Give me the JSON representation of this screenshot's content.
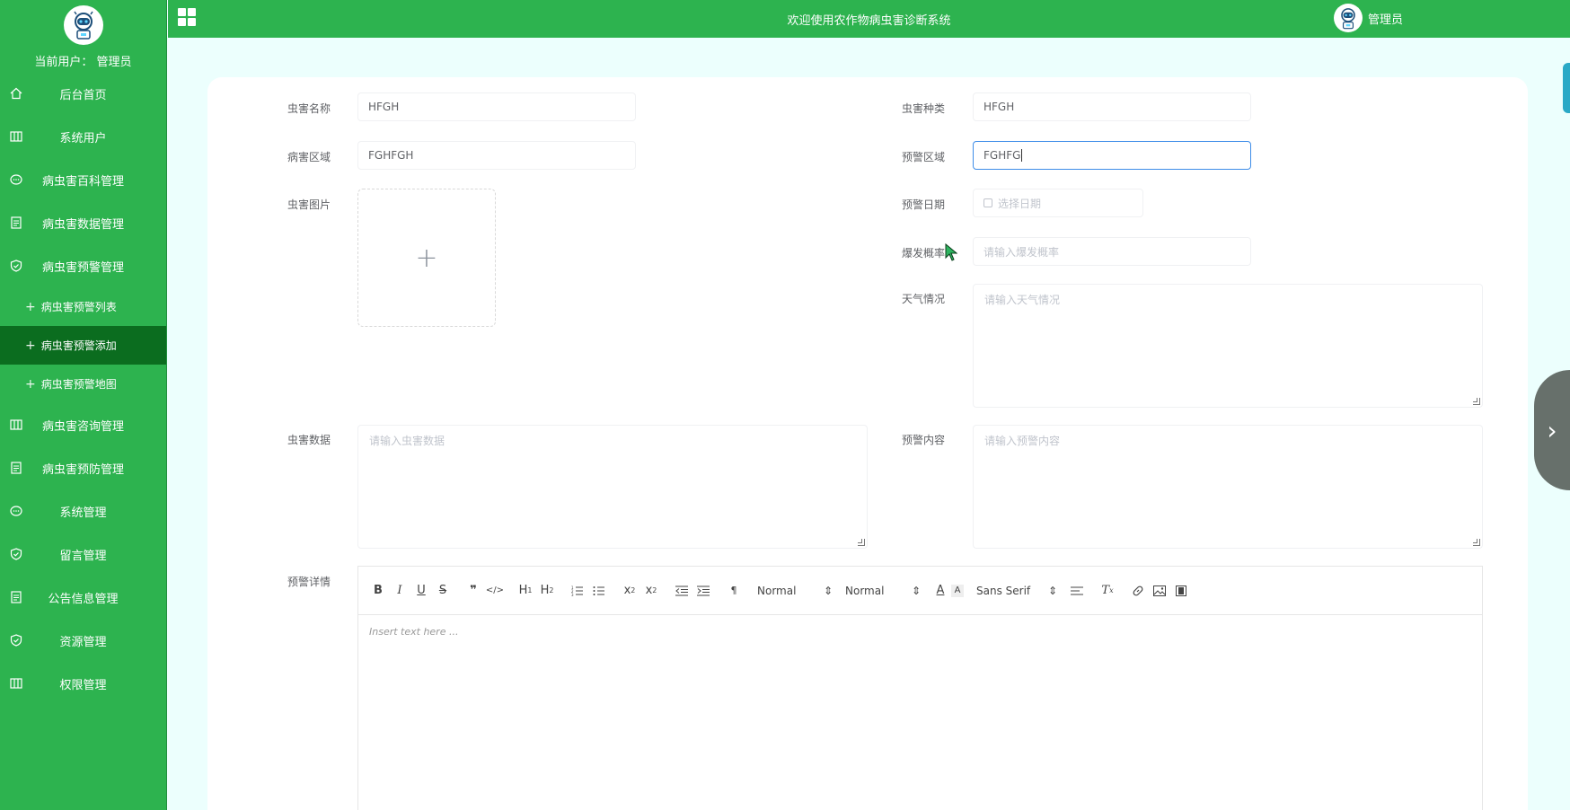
{
  "header": {
    "system_title": "欢迎使用农作物病虫害诊断系统",
    "user_name": "管理员"
  },
  "sidebar": {
    "current_user": "当前用户：  管理员",
    "items": [
      {
        "label": "后台首页",
        "icon": "home-icon"
      },
      {
        "label": "系统用户",
        "icon": "columns-icon"
      },
      {
        "label": "病虫害百科管理",
        "icon": "chat-icon"
      },
      {
        "label": "病虫害数据管理",
        "icon": "document-icon"
      },
      {
        "label": "病虫害预警管理",
        "icon": "shield-check-icon"
      }
    ],
    "sub_items": [
      {
        "label": "病虫害预警列表",
        "active": false
      },
      {
        "label": "病虫害预警添加",
        "active": true
      },
      {
        "label": "病虫害预警地图",
        "active": false
      }
    ],
    "items_after": [
      {
        "label": "病虫害咨询管理",
        "icon": "columns-icon"
      },
      {
        "label": "病虫害预防管理",
        "icon": "document-icon"
      },
      {
        "label": "系统管理",
        "icon": "chat-icon"
      },
      {
        "label": "留言管理",
        "icon": "shield-check-icon"
      },
      {
        "label": "公告信息管理",
        "icon": "document-icon"
      },
      {
        "label": "资源管理",
        "icon": "shield-check-icon"
      },
      {
        "label": "权限管理",
        "icon": "columns-icon"
      }
    ]
  },
  "form": {
    "pest_name": {
      "label": "虫害名称",
      "value": "HFGH"
    },
    "pest_type": {
      "label": "虫害种类",
      "value": "HFGH"
    },
    "disease_area": {
      "label": "病害区域",
      "value": "FGHFGH"
    },
    "warning_area": {
      "label": "预警区域",
      "value": "FGHFG"
    },
    "pest_image": {
      "label": "虫害图片",
      "upload_symbol": "+"
    },
    "warning_date": {
      "label": "预警日期",
      "placeholder": "选择日期"
    },
    "outbreak_rate": {
      "label": "爆发概率",
      "placeholder": "请输入爆发概率"
    },
    "weather": {
      "label": "天气情况",
      "placeholder": "请输入天气情况"
    },
    "pest_data": {
      "label": "虫害数据",
      "placeholder": "请输入虫害数据"
    },
    "warning_content": {
      "label": "预警内容",
      "placeholder": "请输入预警内容"
    },
    "warning_detail": {
      "label": "预警详情",
      "placeholder": "Insert text here ..."
    }
  },
  "editor_toolbar": {
    "header_select": "Normal",
    "size_select": "Normal",
    "font_select": "Sans Serif"
  }
}
